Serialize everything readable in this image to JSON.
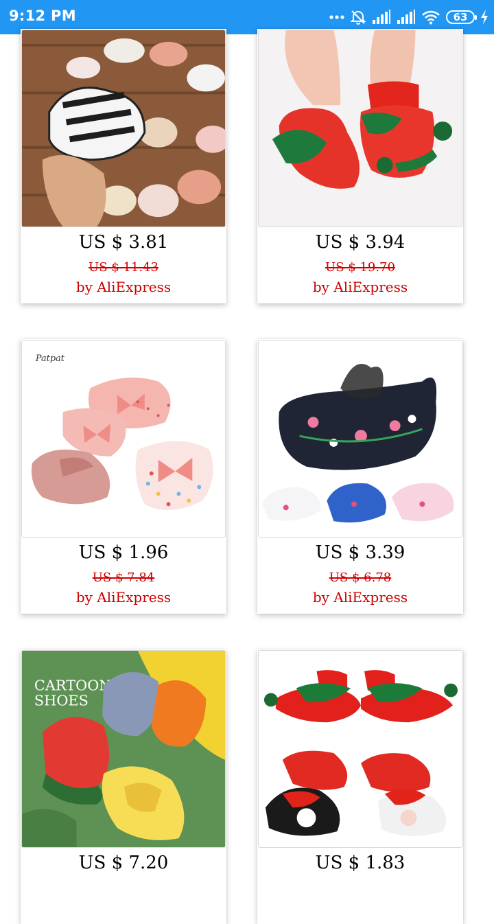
{
  "status_bar": {
    "time": "9:12 PM",
    "battery": "63",
    "icons": [
      "more-dots-icon",
      "alarm-off-icon",
      "signal-icon",
      "signal-icon",
      "wifi-icon",
      "battery-icon",
      "charging-icon"
    ]
  },
  "colors": {
    "status_bar": "#2196f3",
    "price": "#000000",
    "sale_accent": "#cc0000"
  },
  "products": [
    {
      "price": "US $ 3.81",
      "original_price": "US $ 11.43",
      "seller": "by AliExpress"
    },
    {
      "price": "US $ 3.94",
      "original_price": "US $ 19.70",
      "seller": "by AliExpress"
    },
    {
      "price": "US $ 1.96",
      "original_price": "US $ 7.84",
      "seller": "by AliExpress"
    },
    {
      "price": "US $ 3.39",
      "original_price": "US $ 6.78",
      "seller": "by AliExpress"
    },
    {
      "price": "US $ 7.20",
      "original_price": "",
      "seller": ""
    },
    {
      "price": "US $ 1.83",
      "original_price": "",
      "seller": ""
    }
  ],
  "image_text": {
    "brand_mark": "Patpat",
    "promo_title": "CARTOON",
    "promo_subtitle": "SHOES"
  }
}
